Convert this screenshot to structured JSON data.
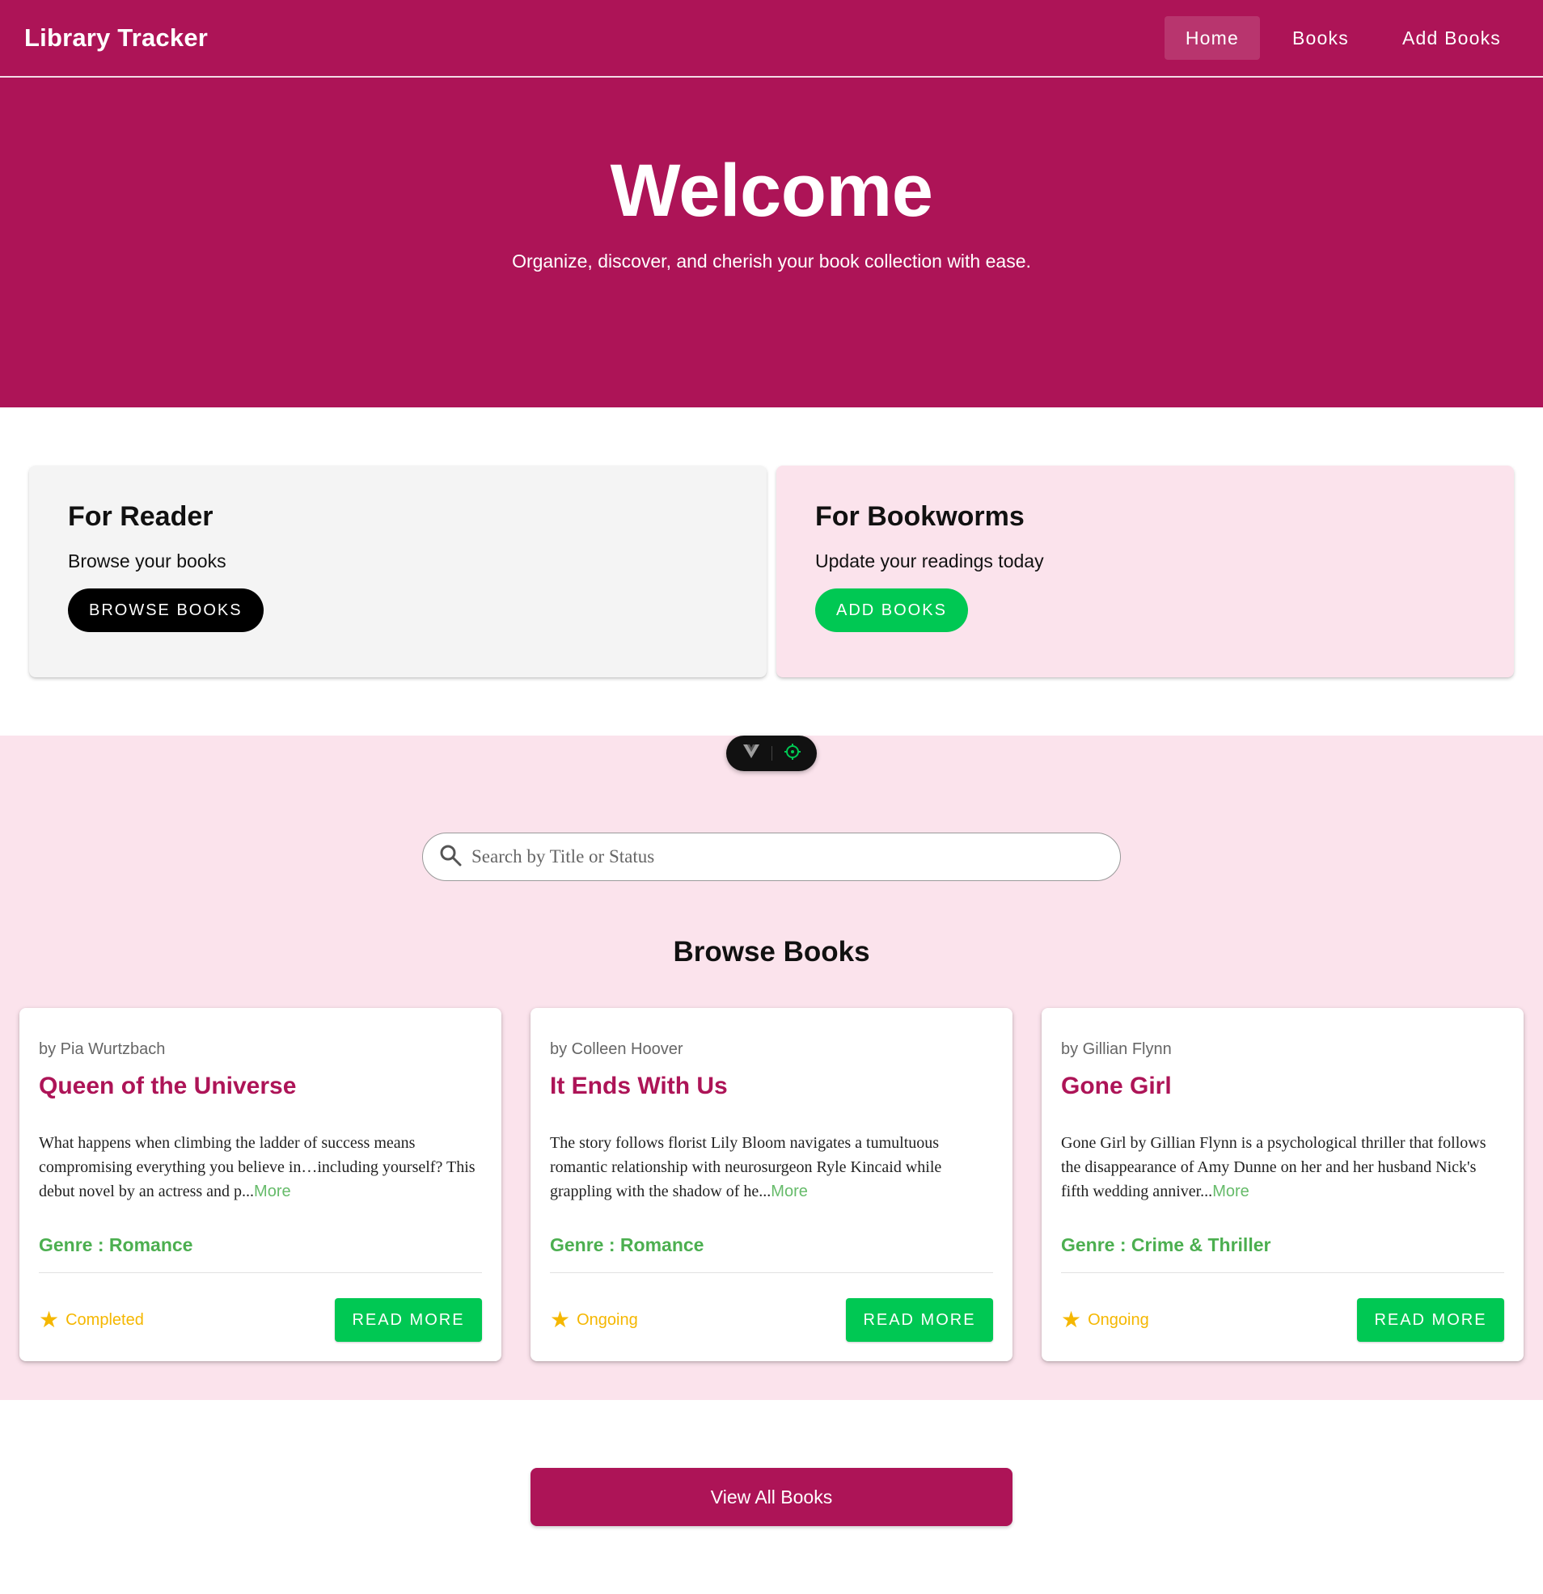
{
  "navbar": {
    "brand": "Library Tracker",
    "links": [
      {
        "label": "Home",
        "active": true
      },
      {
        "label": "Books",
        "active": false
      },
      {
        "label": "Add Books",
        "active": false
      }
    ]
  },
  "hero": {
    "title": "Welcome",
    "subtitle": "Organize, discover, and cherish your book collection with ease."
  },
  "features": {
    "reader": {
      "title": "For Reader",
      "text": "Browse your books",
      "button": "BROWSE BOOKS"
    },
    "bookworms": {
      "title": "For Bookworms",
      "text": "Update your readings today",
      "button": "ADD BOOKS"
    }
  },
  "search": {
    "placeholder": "Search by Title or Status"
  },
  "browse": {
    "title": "Browse Books",
    "books": [
      {
        "author": "by Pia Wurtzbach",
        "title": "Queen of the Universe",
        "description": "What happens when climbing the ladder of success means compromising everything you believe in…including yourself? This debut novel by an actress and p...",
        "more": "More",
        "genre": "Genre : Romance",
        "status": "Completed",
        "button": "READ MORE"
      },
      {
        "author": "by Colleen Hoover",
        "title": "It Ends With Us",
        "description": "The story follows florist Lily Bloom navigates a tumultuous romantic relationship with neurosurgeon Ryle Kincaid while grappling with the shadow of he...",
        "more": "More",
        "genre": "Genre : Romance",
        "status": "Ongoing",
        "button": "READ MORE"
      },
      {
        "author": "by Gillian Flynn",
        "title": "Gone Girl",
        "description": "Gone Girl by Gillian Flynn is a psychological thriller that follows the disappearance of Amy Dunne on her and her husband Nick's fifth wedding anniver...",
        "more": "More",
        "genre": "Genre : Crime & Thriller",
        "status": "Ongoing",
        "button": "READ MORE"
      }
    ]
  },
  "view_all": "View All Books",
  "icons": {
    "search": "search-icon",
    "star": "star-icon",
    "vue_devtools": "vue-logo-icon",
    "inspector": "crosshair-icon"
  },
  "colors": {
    "primary": "#ad1457",
    "accent_green": "#00c853",
    "genre_green": "#4caf50",
    "status_yellow": "#f5b700",
    "pink_bg": "#fbe3ec"
  }
}
